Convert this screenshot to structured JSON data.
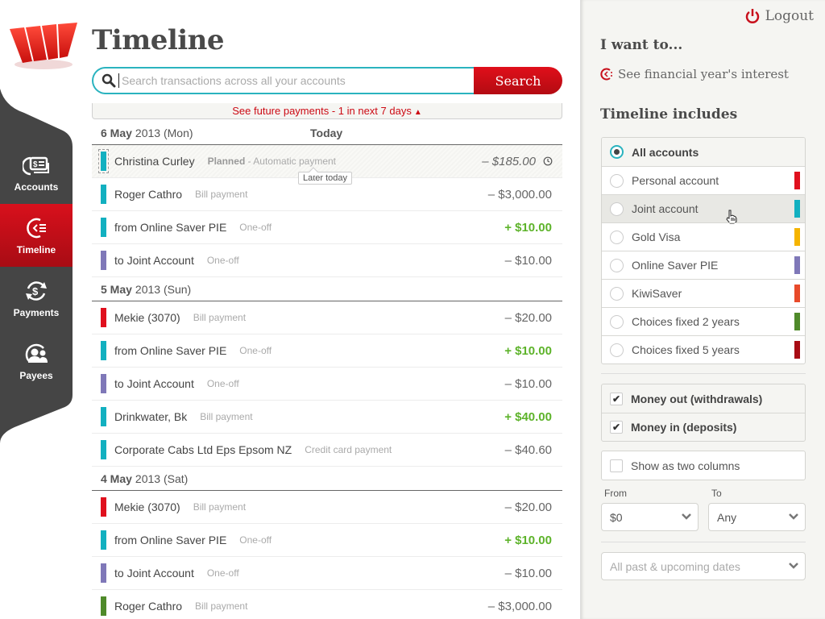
{
  "app": {
    "title": "Timeline",
    "brand_color": "#d8101c",
    "accent_color": "#2ab3bf"
  },
  "nav": {
    "items": [
      {
        "label": "Accounts",
        "icon": "accounts-icon",
        "active": false
      },
      {
        "label": "Timeline",
        "icon": "timeline-icon",
        "active": true
      },
      {
        "label": "Payments",
        "icon": "payments-icon",
        "active": false
      },
      {
        "label": "Payees",
        "icon": "payees-icon",
        "active": false
      }
    ]
  },
  "search": {
    "placeholder": "Search transactions across all your accounts",
    "value": "",
    "button_label": "Search"
  },
  "future_payments": {
    "label": "See future payments - 1 in next 7 days",
    "icon": "chevron-up-icon"
  },
  "later_today_label": "Later today",
  "timeline": [
    {
      "date_bold": "6 May",
      "date_rest": "2013 (Mon)",
      "today_label": "Today",
      "transactions": [
        {
          "name": "Christina Curley",
          "status": "Planned",
          "type": "- Automatic payment",
          "amount": "– $185.00",
          "direction": "out",
          "color": "#12b0c0",
          "planned": true
        },
        {
          "name": "Roger Cathro",
          "type": "Bill payment",
          "amount": "– $3,000.00",
          "direction": "out",
          "color": "#12b0c0"
        },
        {
          "name": "from Online Saver PIE",
          "type": "One-off",
          "amount": "+ $10.00",
          "direction": "in",
          "color": "#12b0c0"
        },
        {
          "name": "to Joint Account",
          "type": "One-off",
          "amount": "– $10.00",
          "direction": "out",
          "color": "#7f78b8"
        }
      ]
    },
    {
      "date_bold": "5 May",
      "date_rest": "2013 (Sun)",
      "transactions": [
        {
          "name": "Mekie (3070)",
          "type": "Bill payment",
          "amount": "– $20.00",
          "direction": "out",
          "color": "#e0101e"
        },
        {
          "name": "from Online Saver PIE",
          "type": "One-off",
          "amount": "+ $10.00",
          "direction": "in",
          "color": "#12b0c0"
        },
        {
          "name": "to Joint Account",
          "type": "One-off",
          "amount": "– $10.00",
          "direction": "out",
          "color": "#7f78b8"
        },
        {
          "name": "Drinkwater, Bk",
          "type": "Bill payment",
          "amount": "+ $40.00",
          "direction": "in",
          "color": "#12b0c0"
        },
        {
          "name": "Corporate Cabs Ltd Eps Epsom NZ",
          "type": "Credit card payment",
          "amount": "– $40.60",
          "direction": "out",
          "color": "#12b0c0"
        }
      ]
    },
    {
      "date_bold": "4 May",
      "date_rest": "2013 (Sat)",
      "transactions": [
        {
          "name": "Mekie (3070)",
          "type": "Bill payment",
          "amount": "– $20.00",
          "direction": "out",
          "color": "#e0101e"
        },
        {
          "name": "from Online Saver PIE",
          "type": "One-off",
          "amount": "+ $10.00",
          "direction": "in",
          "color": "#12b0c0"
        },
        {
          "name": "to Joint Account",
          "type": "One-off",
          "amount": "– $10.00",
          "direction": "out",
          "color": "#7f78b8"
        },
        {
          "name": "Roger Cathro",
          "type": "Bill payment",
          "amount": "– $3,000.00",
          "direction": "out",
          "color": "#4f8a2a"
        }
      ]
    }
  ],
  "side": {
    "logout_label": "Logout",
    "i_want_to_heading": "I want to...",
    "interest_link": "See financial year's interest",
    "timeline_includes_heading": "Timeline includes",
    "accounts": [
      {
        "label": "All accounts",
        "selected": true,
        "color": null
      },
      {
        "label": "Personal account",
        "selected": false,
        "color": "#e0101e"
      },
      {
        "label": "Joint account",
        "selected": false,
        "color": "#12b0c0",
        "hover": true
      },
      {
        "label": "Gold Visa",
        "selected": false,
        "color": "#f5b400"
      },
      {
        "label": "Online Saver PIE",
        "selected": false,
        "color": "#7f78b8"
      },
      {
        "label": "KiwiSaver",
        "selected": false,
        "color": "#e84a2a"
      },
      {
        "label": "Choices fixed 2 years",
        "selected": false,
        "color": "#4f8a2a"
      },
      {
        "label": "Choices fixed 5 years",
        "selected": false,
        "color": "#a80c14"
      }
    ],
    "money_filters": [
      {
        "label": "Money out (withdrawals)",
        "checked": true
      },
      {
        "label": "Money in (deposits)",
        "checked": true
      }
    ],
    "two_columns": {
      "label": "Show as two columns",
      "checked": false
    },
    "from_label": "From",
    "from_value": "$0",
    "to_label": "To",
    "to_value": "Any",
    "date_range_value": "All past & upcoming dates"
  }
}
